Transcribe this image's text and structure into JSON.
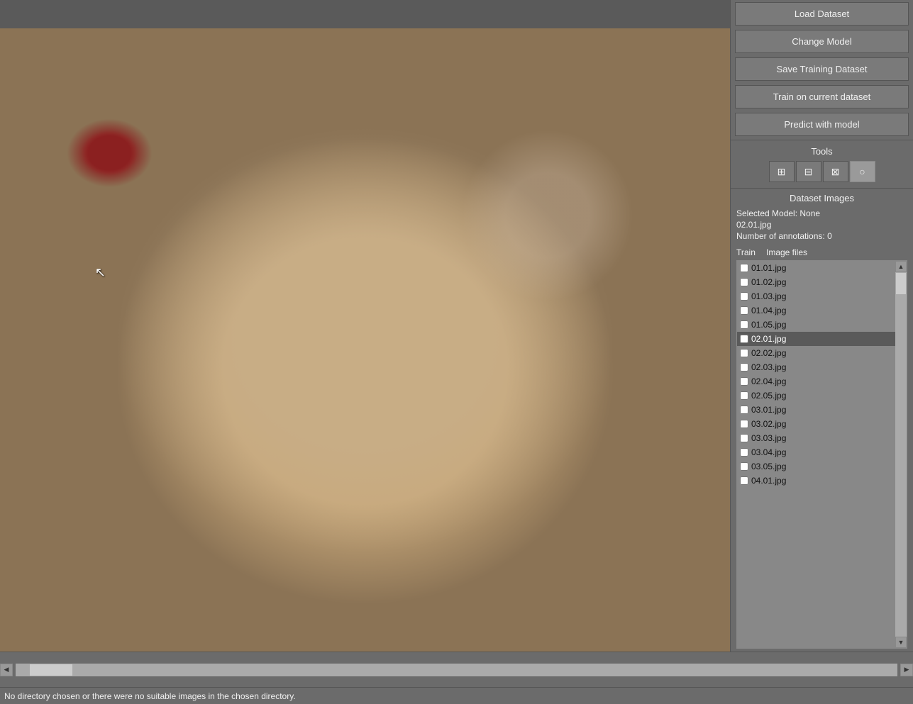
{
  "buttons": {
    "load_dataset": "Load Dataset",
    "change_model": "Change Model",
    "save_training": "Save Training Dataset",
    "train_current": "Train on current dataset",
    "predict_model": "Predict with model"
  },
  "tools": {
    "label": "Tools",
    "items": [
      {
        "id": "add-box",
        "symbol": "+",
        "title": "Add box"
      },
      {
        "id": "edit-box",
        "symbol": "▣",
        "title": "Edit box"
      },
      {
        "id": "remove-box",
        "symbol": "✕",
        "title": "Remove box"
      },
      {
        "id": "circle-tool",
        "symbol": "○",
        "title": "Circle tool",
        "active": true
      }
    ]
  },
  "dataset": {
    "title": "Dataset Images",
    "selected_model_label": "Selected Model: None",
    "current_file": "02.01.jpg",
    "annotations": "Number of annotations: 0"
  },
  "file_list": {
    "col_train": "Train",
    "col_images": "Image files",
    "files": [
      {
        "name": "01.01.jpg",
        "checked": false
      },
      {
        "name": "01.02.jpg",
        "checked": false
      },
      {
        "name": "01.03.jpg",
        "checked": false
      },
      {
        "name": "01.04.jpg",
        "checked": false
      },
      {
        "name": "01.05.jpg",
        "checked": false
      },
      {
        "name": "02.01.jpg",
        "checked": false,
        "selected": true
      },
      {
        "name": "02.02.jpg",
        "checked": false
      },
      {
        "name": "02.03.jpg",
        "checked": false
      },
      {
        "name": "02.04.jpg",
        "checked": false
      },
      {
        "name": "02.05.jpg",
        "checked": false
      },
      {
        "name": "03.01.jpg",
        "checked": false
      },
      {
        "name": "03.02.jpg",
        "checked": false
      },
      {
        "name": "03.03.jpg",
        "checked": false
      },
      {
        "name": "03.04.jpg",
        "checked": false
      },
      {
        "name": "03.05.jpg",
        "checked": false
      },
      {
        "name": "04.01.jpg",
        "checked": false
      }
    ]
  },
  "status_bar": {
    "text": "No directory chosen or there were no suitable images in the chosen directory."
  }
}
